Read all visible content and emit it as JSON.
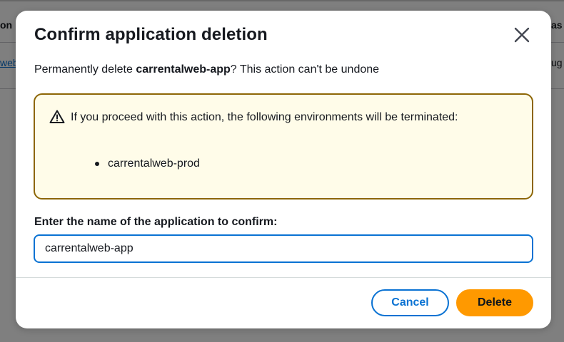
{
  "background": {
    "left_header_fragment": "on",
    "right_header_fragment": "as",
    "left_link_fragment": "web",
    "right_cell_fragment": "ug"
  },
  "modal": {
    "title": "Confirm application deletion",
    "close_icon": "close-icon",
    "description_prefix": "Permanently delete ",
    "app_name": "carrentalweb-app",
    "description_suffix": "? This action can't be undone",
    "alert": {
      "icon": "warning-icon",
      "text": "If you proceed with this action, the following environments will be terminated:",
      "environments": [
        "carrentalweb-prod"
      ]
    },
    "confirm_label": "Enter the name of the application to confirm:",
    "confirm_value": "carrentalweb-app",
    "cancel_label": "Cancel",
    "delete_label": "Delete"
  },
  "colors": {
    "accent": "#0972d3",
    "warning_border": "#8d6605",
    "warning_bg": "#fffce9",
    "primary_button": "#ff9900"
  }
}
